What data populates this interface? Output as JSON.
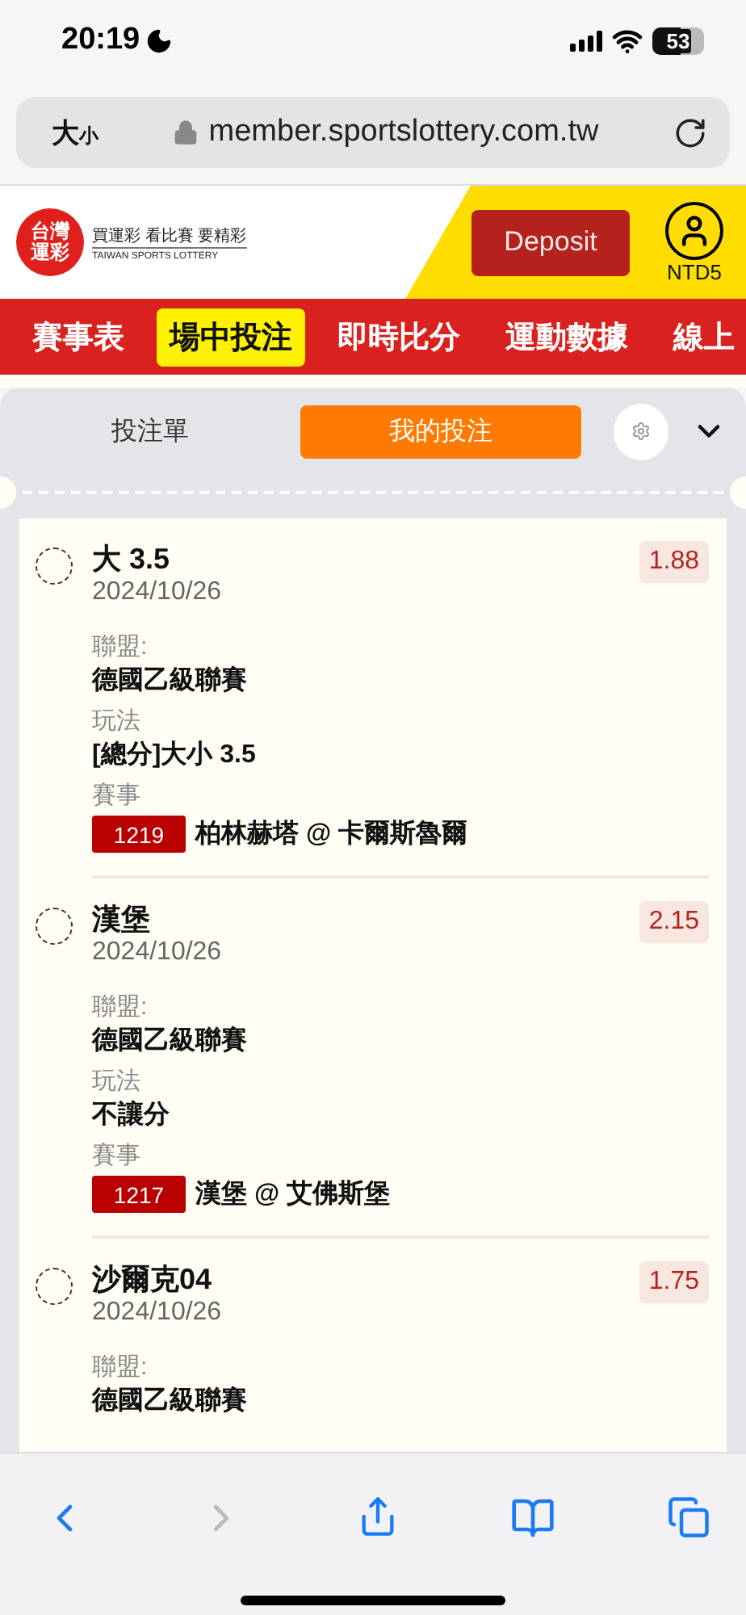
{
  "status_bar": {
    "time": "20:19",
    "battery": "53"
  },
  "browser": {
    "text_size": {
      "large": "大",
      "small": "小"
    },
    "url": "member.sportslottery.com.tw",
    "back_disabled": false,
    "forward_disabled": true
  },
  "site_header": {
    "logo": [
      "台灣",
      "運彩"
    ],
    "slogan": "買運彩 看比賽 要精彩",
    "slogan_en": "TAIWAN SPORTS LOTTERY",
    "deposit_button": "Deposit",
    "balance": "NTD5"
  },
  "nav": [
    {
      "label": "賽事表",
      "selected": false
    },
    {
      "label": "場中投注",
      "selected": true
    },
    {
      "label": "即時比分",
      "selected": false
    },
    {
      "label": "運動數據",
      "selected": false
    },
    {
      "label": "線上",
      "selected": false
    }
  ],
  "bet_tabs": [
    {
      "label": "投注單",
      "selected": false
    },
    {
      "label": "我的投注",
      "selected": true
    }
  ],
  "bets": [
    {
      "checked": false,
      "selection": "大 3.5",
      "date": "2024/10/26",
      "odds": "1.88",
      "fields": [
        {
          "label": "聯盟:",
          "value": "德國乙級聯賽"
        },
        {
          "label": "玩法",
          "value": "[總分]大小 3.5"
        }
      ],
      "event": {
        "label": "賽事",
        "code": "1219",
        "match": "柏林赫塔 @ 卡爾斯魯爾"
      }
    },
    {
      "checked": false,
      "selection": "漢堡",
      "date": "2024/10/26",
      "odds": "2.15",
      "fields": [
        {
          "label": "聯盟:",
          "value": "德國乙級聯賽"
        },
        {
          "label": "玩法",
          "value": "不讓分"
        }
      ],
      "event": {
        "label": "賽事",
        "code": "1217",
        "match": "漢堡 @ 艾佛斯堡"
      }
    },
    {
      "checked": false,
      "selection": "沙爾克04",
      "date": "2024/10/26",
      "odds": "1.75",
      "fields": [
        {
          "label": "聯盟:",
          "value": "德國乙級聯賽"
        }
      ]
    }
  ]
}
